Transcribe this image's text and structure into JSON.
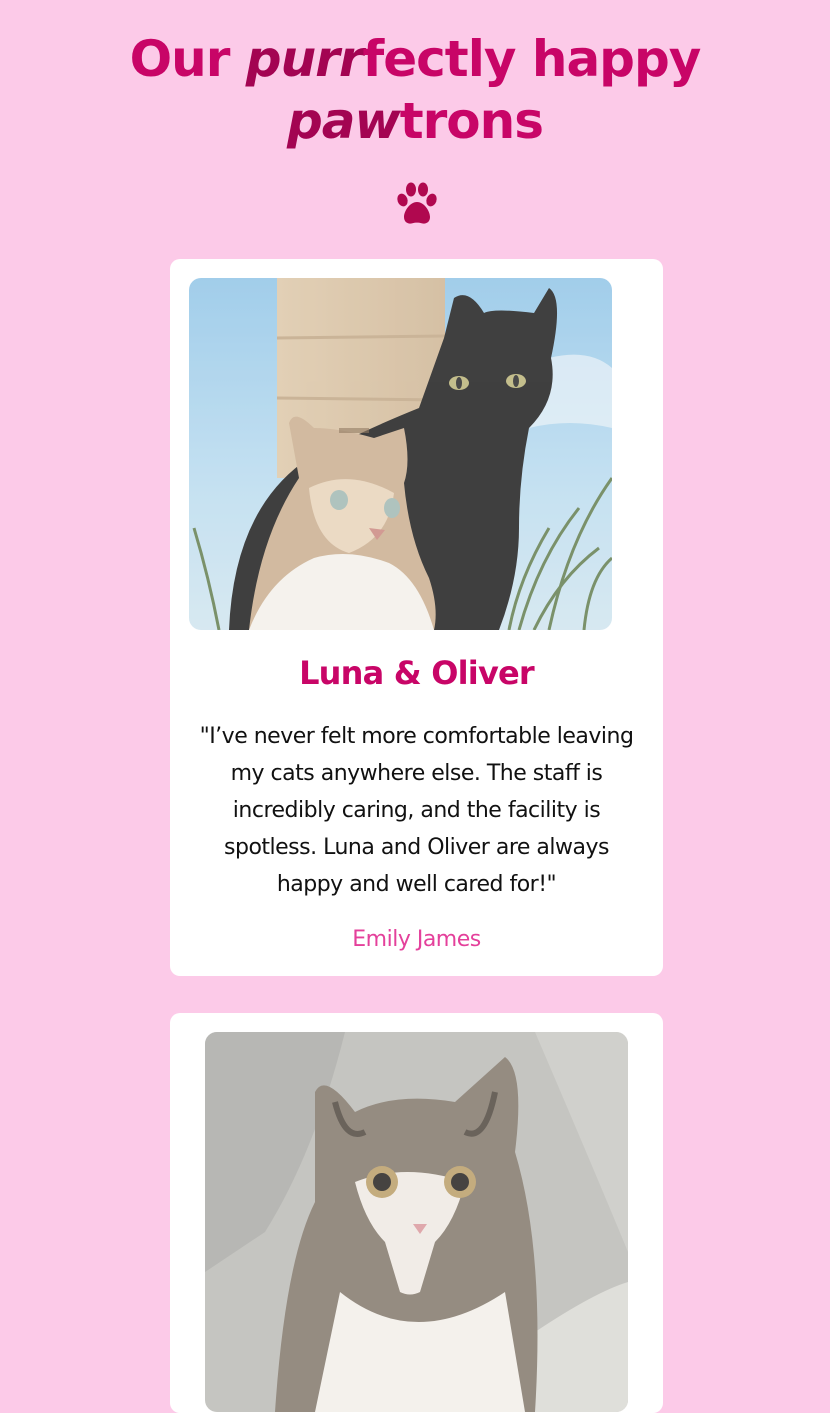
{
  "header": {
    "title_part1": "Our ",
    "title_em1": "purr",
    "title_part2": "fectly happy",
    "title_em2": "paw",
    "title_part3": "trons",
    "icon": "paw-icon",
    "title_color": "#c80567"
  },
  "testimonials": [
    {
      "cat_names": "Luna & Oliver",
      "quote": "\"I’ve never felt more comfortable leaving my cats anywhere else. The staff is incredibly caring, and the facility is spotless. Luna and Oliver are always happy and well cared for!\"",
      "author": "Emily James"
    },
    {}
  ],
  "colors": {
    "background": "#fccae8",
    "accent": "#c80567",
    "author": "#e4409b",
    "card": "#ffffff"
  }
}
